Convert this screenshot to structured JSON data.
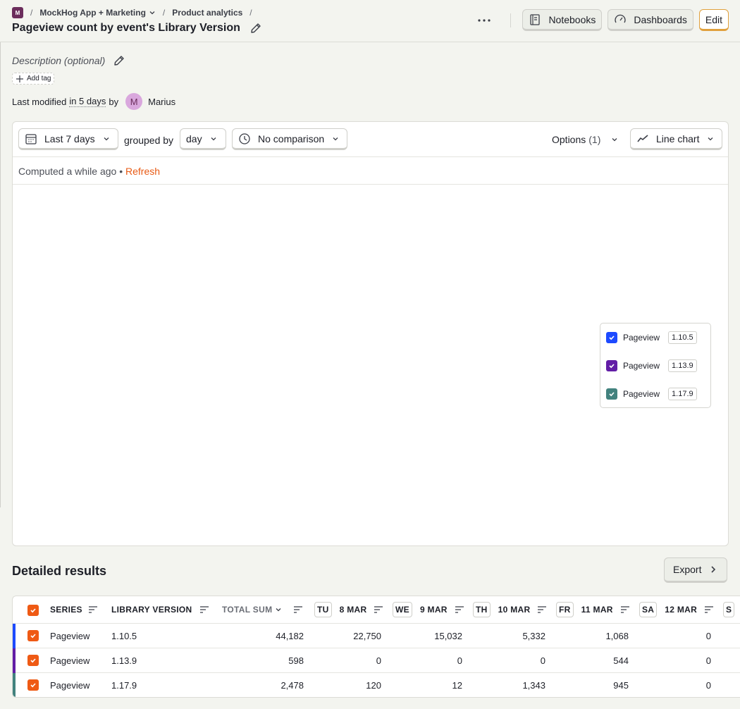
{
  "breadcrumb": {
    "project_initial": "M",
    "project": "MockHog App + Marketing",
    "section": "Product analytics",
    "separator": "/"
  },
  "page": {
    "title": "Pageview count by event's Library Version",
    "description_placeholder": "Description (optional)",
    "add_tag": "Add tag",
    "modified_prefix": "Last modified",
    "modified_when": "in 5 days",
    "modified_by": "by",
    "author_initial": "M",
    "author": "Marius"
  },
  "toolbar": {
    "notebooks": "Notebooks",
    "dashboards": "Dashboards",
    "edit": "Edit"
  },
  "controls": {
    "date_range": "Last 7 days",
    "grouped_by_label": "grouped by",
    "interval": "day",
    "comparison": "No comparison",
    "options": "Options",
    "options_count": "(1)",
    "chart_type": "Line chart"
  },
  "status": {
    "computed": "Computed a while ago",
    "bullet": "•",
    "refresh": "Refresh"
  },
  "legend": [
    {
      "event": "Pageview",
      "version": "1.10.5",
      "color": "#1d4aff"
    },
    {
      "event": "Pageview",
      "version": "1.13.9",
      "color": "#621da6"
    },
    {
      "event": "Pageview",
      "version": "1.17.9",
      "color": "#42827e"
    }
  ],
  "results": {
    "title": "Detailed results",
    "export": "Export",
    "columns": {
      "series": "SERIES",
      "library_version": "LIBRARY VERSION",
      "total_sum": "TOTAL SUM",
      "days": [
        {
          "abbr": "TU",
          "date": "8 MAR"
        },
        {
          "abbr": "WE",
          "date": "9 MAR"
        },
        {
          "abbr": "TH",
          "date": "10 MAR"
        },
        {
          "abbr": "FR",
          "date": "11 MAR"
        },
        {
          "abbr": "SA",
          "date": "12 MAR"
        },
        {
          "abbr": "S",
          "date": ""
        }
      ]
    },
    "rows": [
      {
        "series": "Pageview",
        "version": "1.10.5",
        "total": "44,182",
        "values": [
          "22,750",
          "15,032",
          "5,332",
          "1,068",
          "0"
        ],
        "color": "#1d4aff"
      },
      {
        "series": "Pageview",
        "version": "1.13.9",
        "total": "598",
        "values": [
          "0",
          "0",
          "0",
          "544",
          "0"
        ],
        "color": "#621da6"
      },
      {
        "series": "Pageview",
        "version": "1.17.9",
        "total": "2,478",
        "values": [
          "120",
          "12",
          "1,343",
          "945",
          "0"
        ],
        "color": "#42827e"
      }
    ]
  }
}
